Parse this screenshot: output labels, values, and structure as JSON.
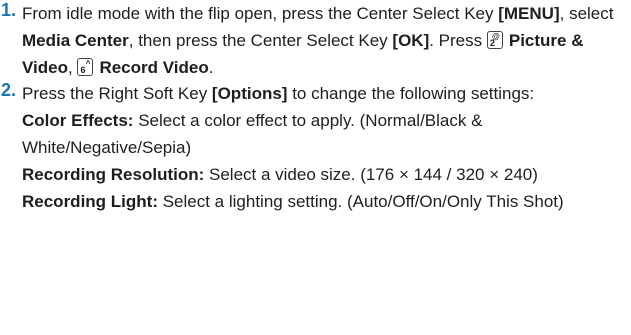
{
  "step1": {
    "number": "1.",
    "part1": "From idle mode with the flip open, press the Center Select Key ",
    "menu_key": "[MENU]",
    "part2": ", select ",
    "media_center": "Media Center",
    "part3": ", then press the Center Select Key ",
    "ok_key": "[OK]",
    "part4": ". Press ",
    "key2_digit": "2",
    "key2_symbol": "@",
    "picture_video": "Picture & Video",
    "comma": ", ",
    "key6_digit": "6",
    "key6_symbol": "^",
    "record_video": "Record Video",
    "end": "."
  },
  "step2": {
    "number": "2.",
    "part1": "Press the Right Soft Key ",
    "options_key": "[Options]",
    "part2": " to change the following settings:",
    "settings": [
      {
        "label": "Color Effects:",
        "text": " Select a color effect to apply. (Normal/Black & White/Negative/Sepia)"
      },
      {
        "label": "Recording Resolution:",
        "text": " Select a video size. (176 × 144 / 320 × 240)"
      },
      {
        "label": "Recording Light:",
        "text": " Select a lighting setting. (Auto/Off/On/Only This Shot)"
      }
    ]
  },
  "colors": {
    "step_number": "#1a73b7",
    "text": "#1e1e1e"
  },
  "icons": [
    "keypad-2-icon",
    "keypad-6-icon"
  ]
}
